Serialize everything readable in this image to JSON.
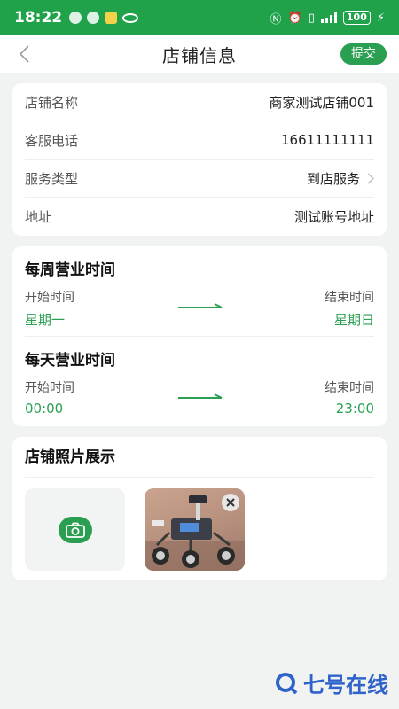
{
  "status_bar": {
    "time": "18:22",
    "battery": "100"
  },
  "header": {
    "title": "店铺信息",
    "submit_label": "提交"
  },
  "store_info": {
    "rows": [
      {
        "label": "店铺名称",
        "value": "商家测试店铺001"
      },
      {
        "label": "客服电话",
        "value": "16611111111"
      },
      {
        "label": "服务类型",
        "value": "到店服务"
      },
      {
        "label": "地址",
        "value": "测试账号地址"
      }
    ]
  },
  "hours": {
    "weekly": {
      "title": "每周营业时间",
      "start_label": "开始时间",
      "end_label": "结束时间",
      "start_value": "星期一",
      "end_value": "星期日"
    },
    "daily": {
      "title": "每天营业时间",
      "start_label": "开始时间",
      "end_label": "结束时间",
      "start_value": "00:00",
      "end_value": "23:00"
    }
  },
  "photos": {
    "title": "店铺照片展示"
  },
  "watermark": {
    "text": "七号在线"
  },
  "colors": {
    "accent": "#2a9f52",
    "statusbar": "#1fa24a",
    "watermark": "#2f63c9"
  }
}
